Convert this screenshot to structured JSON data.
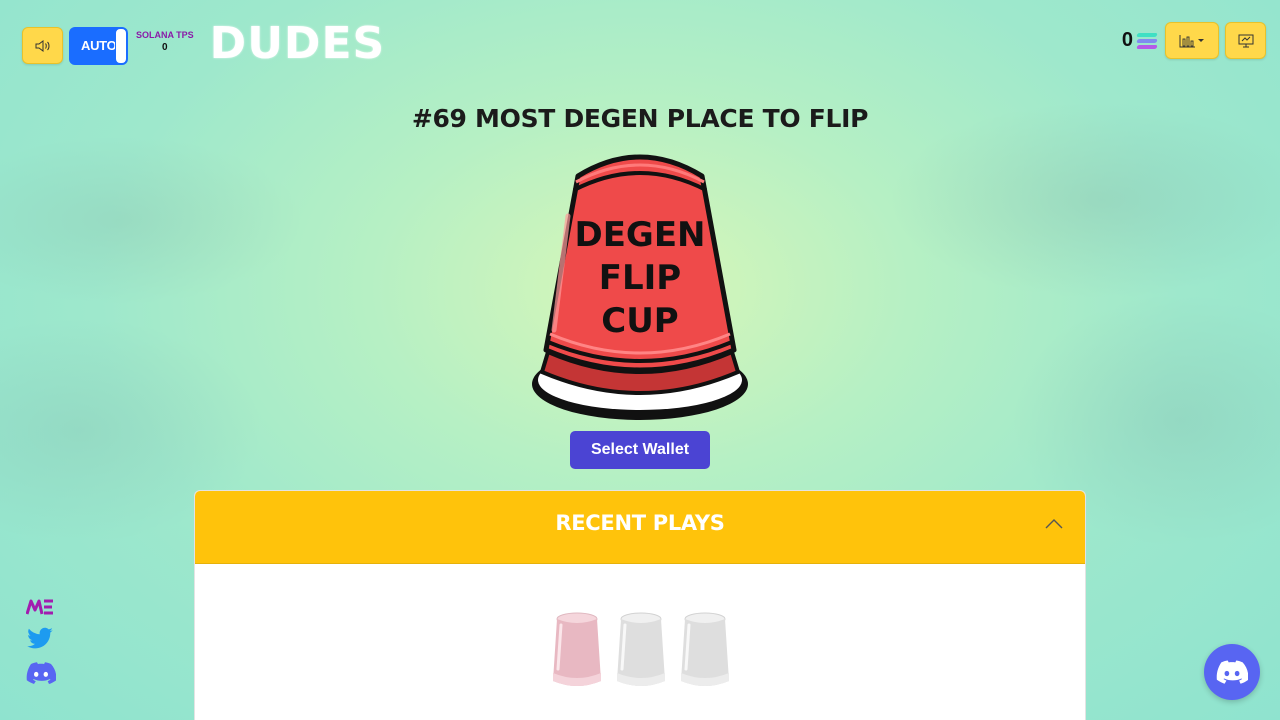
{
  "header": {
    "auto_label": "AUTO",
    "tps_label": "SOLANA TPS",
    "tps_value": "0",
    "logo": "DUDES",
    "balance": "0",
    "icons": {
      "sound": "speaker-icon",
      "stats": "bar-chart-icon",
      "screen": "monitor-icon",
      "currency": "solana-icon"
    }
  },
  "main": {
    "headline": "#69 MOST DEGEN PLACE TO FLIP",
    "cup_lines": [
      "DEGEN",
      "FLIP",
      "CUP"
    ],
    "select_wallet": "Select Wallet"
  },
  "recent": {
    "title": "RECENT PLAYS"
  },
  "social": {
    "items": [
      "magic-eden-icon",
      "twitter-icon",
      "discord-icon"
    ]
  },
  "colors": {
    "accent_yellow": "#ffc30b",
    "button_yellow": "#ffd84a",
    "wallet_button": "#4b44d3",
    "toggle_blue": "#1a6dff",
    "cup_red": "#ef4a4a",
    "discord": "#5865f2",
    "magic_eden": "#a21caf",
    "twitter": "#1d9bf0"
  }
}
